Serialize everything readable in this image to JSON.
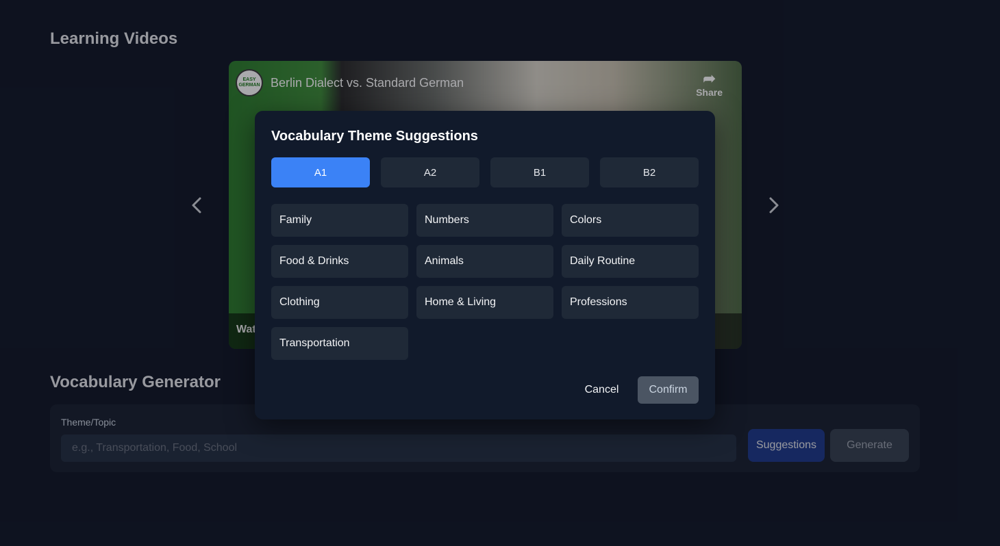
{
  "sections": {
    "videos_title": "Learning Videos",
    "generator_title": "Vocabulary Generator"
  },
  "video": {
    "title": "Berlin Dialect vs. Standard German",
    "channel_logo_text": "EASY GERMAN",
    "share_label": "Share",
    "watch_label": "Wat"
  },
  "carousel": {
    "prev_icon": "chevron-left-icon",
    "next_icon": "chevron-right-icon"
  },
  "generator": {
    "field_label": "Theme/Topic",
    "input_placeholder": "e.g., Transportation, Food, School",
    "input_value": "",
    "suggestions_label": "Suggestions",
    "generate_label": "Generate"
  },
  "modal": {
    "title": "Vocabulary Theme Suggestions",
    "levels": [
      "A1",
      "A2",
      "B1",
      "B2"
    ],
    "active_level": "A1",
    "themes": [
      "Family",
      "Numbers",
      "Colors",
      "Food & Drinks",
      "Animals",
      "Daily Routine",
      "Clothing",
      "Home & Living",
      "Professions",
      "Transportation"
    ],
    "cancel_label": "Cancel",
    "confirm_label": "Confirm"
  }
}
